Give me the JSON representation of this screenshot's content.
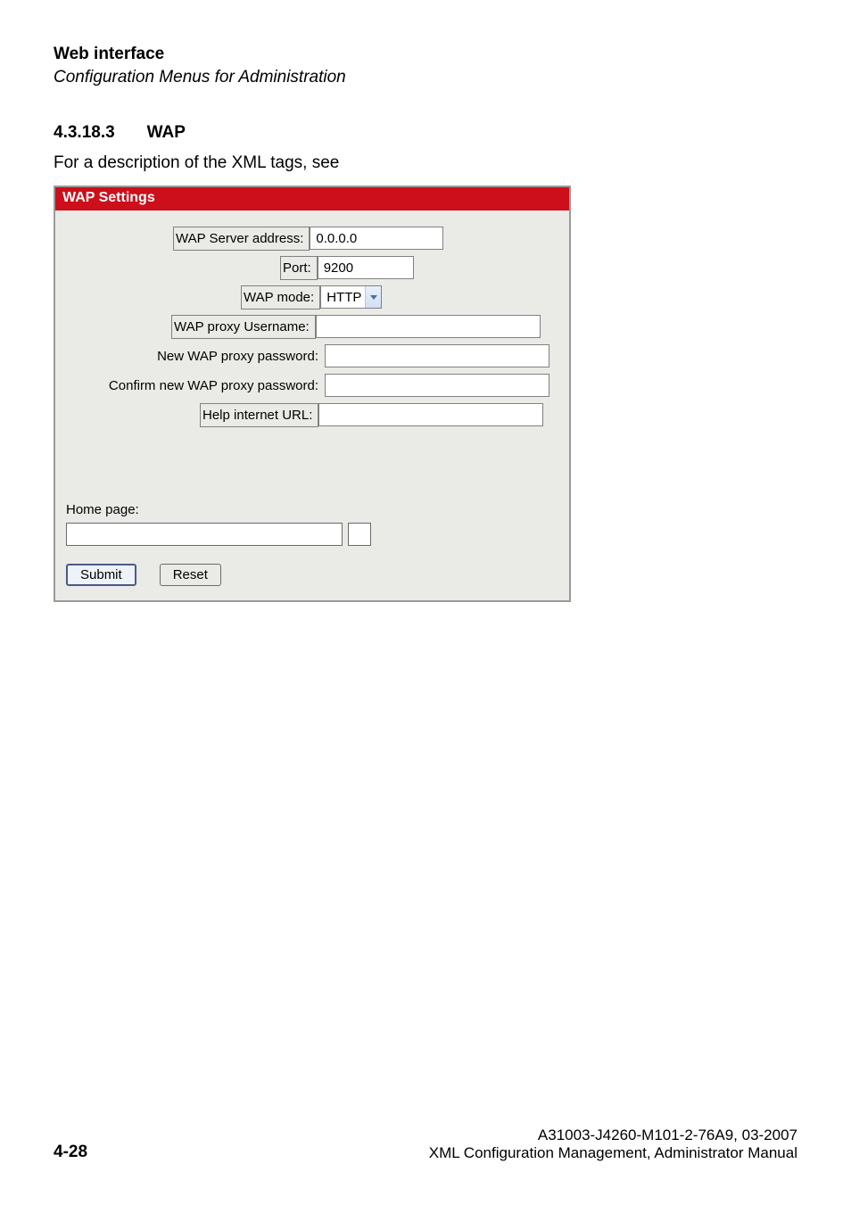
{
  "header": {
    "title": "Web interface",
    "subtitle": "Configuration Menus for Administration"
  },
  "section": {
    "number": "4.3.18.3",
    "title": "WAP"
  },
  "intro": "For a description of the XML tags, see",
  "panel": {
    "title": "WAP Settings",
    "labels": {
      "wap_server_address": "WAP Server address:",
      "port": "Port:",
      "wap_mode": "WAP mode:",
      "wap_proxy_username": "WAP proxy Username:",
      "new_wap_proxy_password": "New WAP proxy password:",
      "confirm_new_wap_proxy_password": "Confirm new WAP proxy password:",
      "help_internet_url": "Help internet URL:",
      "home_page": "Home page:"
    },
    "values": {
      "wap_server_address": "0.0.0.0",
      "port": "9200",
      "wap_mode": "HTTP",
      "wap_proxy_username": "",
      "new_wap_proxy_password": "",
      "confirm_new_wap_proxy_password": "",
      "help_internet_url": "",
      "home_page": ""
    },
    "buttons": {
      "submit": "Submit",
      "reset": "Reset"
    }
  },
  "footer": {
    "page": "4-28",
    "doc_id": "A31003-J4260-M101-2-76A9, 03-2007",
    "doc_title": "XML Configuration Management, Administrator Manual"
  }
}
